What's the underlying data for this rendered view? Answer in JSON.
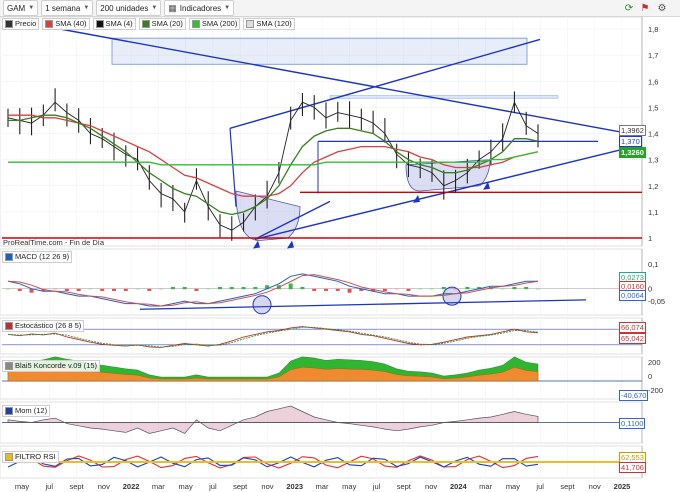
{
  "toolbar": {
    "ticker": "GAM",
    "timeframe": "1 semana",
    "units": "200 unidades",
    "indicators": "Indicadores"
  },
  "legend_main": [
    {
      "label": "Precio",
      "color": "#333333"
    },
    {
      "label": "SMA (40)",
      "color": "#d94040"
    },
    {
      "label": "SMA (4)",
      "color": "#111111"
    },
    {
      "label": "SMA (20)",
      "color": "#3a7d20"
    },
    {
      "label": "SMA (200)",
      "color": "#30c030"
    },
    {
      "label": "SMA (120)",
      "color": "#dddddd"
    }
  ],
  "panel_labels": {
    "source": "ProRealTime.com - Fin de Día",
    "macd": "MACD (12 26 9)",
    "stoch": "Estocástico (26 8 5)",
    "koncorde": "Blai5 Koncorde v.09 (15)",
    "mom": "Mom (12)",
    "rsi": "FILTRO RSI"
  },
  "price_tags": [
    {
      "text": "1,3962",
      "color": "#555555"
    },
    {
      "text": "1,370",
      "color": "#1e3cc8"
    },
    {
      "text": "1,3260",
      "color": "#2aa02a"
    }
  ],
  "indicator_tags": {
    "macd": [
      "0,0273",
      "0,0160",
      "0,0064"
    ],
    "stoch": [
      "66,074",
      "65,042"
    ],
    "koncorde": [
      "-40,670"
    ],
    "mom": [
      "0,1100"
    ],
    "rsi": [
      "62,553",
      "41,706"
    ]
  },
  "chart_data": [
    {
      "type": "line",
      "title": "GAM",
      "subtitle": "1 semana",
      "x_tick_labels": [
        "may",
        "jul",
        "sept",
        "nov",
        "2022",
        "mar",
        "may",
        "jul",
        "sept",
        "nov",
        "2023",
        "mar",
        "may",
        "jul",
        "sept",
        "nov",
        "2024",
        "mar",
        "may",
        "jul",
        "sept",
        "nov",
        "2025"
      ],
      "y_tick_labels": [
        "1",
        "1,1",
        "1,2",
        "1,3",
        "1,4",
        "1,5",
        "1,6",
        "1,7",
        "1,8"
      ],
      "ylim": [
        1.0,
        1.8
      ],
      "series": [
        {
          "name": "Precio",
          "values": [
            1.46,
            1.45,
            1.44,
            1.47,
            1.52,
            1.48,
            1.45,
            1.4,
            1.38,
            1.35,
            1.32,
            1.3,
            1.22,
            1.17,
            1.15,
            1.1,
            1.22,
            1.12,
            1.05,
            1.03,
            1.06,
            1.12,
            1.16,
            1.25,
            1.45,
            1.52,
            1.5,
            1.46,
            1.48,
            1.47,
            1.46,
            1.44,
            1.4,
            1.32,
            1.28,
            1.27,
            1.25,
            1.2,
            1.22,
            1.25,
            1.3,
            1.33,
            1.38,
            1.52,
            1.43,
            1.4
          ]
        },
        {
          "name": "SMA (40)",
          "values": [
            1.47,
            1.47,
            1.47,
            1.46,
            1.46,
            1.45,
            1.44,
            1.43,
            1.41,
            1.39,
            1.37,
            1.35,
            1.33,
            1.3,
            1.27,
            1.24,
            1.23,
            1.21,
            1.19,
            1.17,
            1.16,
            1.16,
            1.16,
            1.17,
            1.2,
            1.25,
            1.29,
            1.31,
            1.33,
            1.34,
            1.35,
            1.35,
            1.35,
            1.34,
            1.33,
            1.31,
            1.3,
            1.28,
            1.27,
            1.27,
            1.27,
            1.28,
            1.29,
            1.31,
            1.32,
            1.33
          ]
        },
        {
          "name": "SMA (20)",
          "values": [
            1.45,
            1.45,
            1.46,
            1.47,
            1.47,
            1.46,
            1.44,
            1.42,
            1.39,
            1.36,
            1.33,
            1.29,
            1.25,
            1.22,
            1.19,
            1.17,
            1.16,
            1.13,
            1.1,
            1.09,
            1.1,
            1.12,
            1.15,
            1.2,
            1.28,
            1.35,
            1.39,
            1.41,
            1.42,
            1.42,
            1.41,
            1.4,
            1.37,
            1.33,
            1.3,
            1.28,
            1.27,
            1.25,
            1.25,
            1.26,
            1.28,
            1.3,
            1.33,
            1.38,
            1.38,
            1.37
          ]
        },
        {
          "name": "SMA (200)",
          "values": [
            1.29,
            1.29,
            1.29,
            1.29,
            1.29,
            1.29,
            1.29,
            1.29,
            1.29,
            1.29,
            1.29,
            1.29,
            1.29,
            1.28,
            1.28,
            1.28,
            1.28,
            1.28,
            1.28,
            1.28,
            1.28,
            1.28,
            1.28,
            1.28,
            1.28,
            1.28,
            1.28,
            1.29,
            1.29,
            1.29,
            1.29,
            1.29,
            1.29,
            1.29,
            1.29,
            1.29,
            1.29,
            1.29,
            1.29,
            1.29,
            1.29,
            1.3,
            1.3,
            1.31,
            1.32,
            1.33
          ]
        }
      ]
    },
    {
      "type": "line",
      "title": "MACD (12 26 9)",
      "y_tick_labels": [
        "0,1",
        "0",
        "-0,05"
      ],
      "ylim": [
        -0.09,
        0.12
      ],
      "series": [
        {
          "name": "MACD",
          "values": [
            0.03,
            0.02,
            0.0,
            -0.01,
            -0.01,
            -0.02,
            -0.03,
            -0.03,
            -0.04,
            -0.05,
            -0.06,
            -0.06,
            -0.07,
            -0.07,
            -0.06,
            -0.05,
            -0.06,
            -0.06,
            -0.05,
            -0.04,
            -0.03,
            -0.02,
            0.0,
            0.02,
            0.05,
            0.06,
            0.05,
            0.04,
            0.03,
            0.01,
            0.0,
            -0.01,
            -0.02,
            -0.02,
            -0.03,
            -0.03,
            -0.03,
            -0.02,
            -0.02,
            -0.01,
            0.0,
            0.01,
            0.01,
            0.02,
            0.03,
            0.03
          ]
        }
      ]
    },
    {
      "type": "line",
      "title": "Estocástico (26 8 5)",
      "ylim": [
        0,
        100
      ],
      "series": [
        {
          "name": "%K",
          "values": [
            60,
            55,
            62,
            58,
            65,
            50,
            40,
            30,
            22,
            18,
            15,
            20,
            12,
            10,
            18,
            25,
            20,
            15,
            22,
            35,
            50,
            60,
            70,
            75,
            85,
            90,
            85,
            80,
            75,
            70,
            60,
            55,
            45,
            35,
            25,
            20,
            22,
            30,
            40,
            50,
            55,
            60,
            70,
            80,
            70,
            66
          ]
        }
      ]
    },
    {
      "type": "line",
      "title": "Mom (12)",
      "ylim": [
        -0.3,
        0.3
      ],
      "series": [
        {
          "name": "Mom",
          "values": [
            0.05,
            0.02,
            0.0,
            0.05,
            0.08,
            -0.02,
            -0.06,
            -0.1,
            -0.12,
            -0.15,
            -0.18,
            -0.1,
            -0.2,
            -0.15,
            -0.1,
            -0.2,
            0.05,
            -0.1,
            -0.15,
            -0.05,
            0.05,
            0.1,
            0.2,
            0.25,
            0.3,
            0.2,
            0.1,
            0.05,
            0.0,
            -0.02,
            -0.05,
            -0.08,
            -0.12,
            -0.15,
            -0.12,
            -0.08,
            -0.05,
            0.0,
            0.02,
            0.05,
            0.08,
            0.1,
            0.15,
            0.2,
            0.15,
            0.11
          ]
        }
      ]
    }
  ]
}
